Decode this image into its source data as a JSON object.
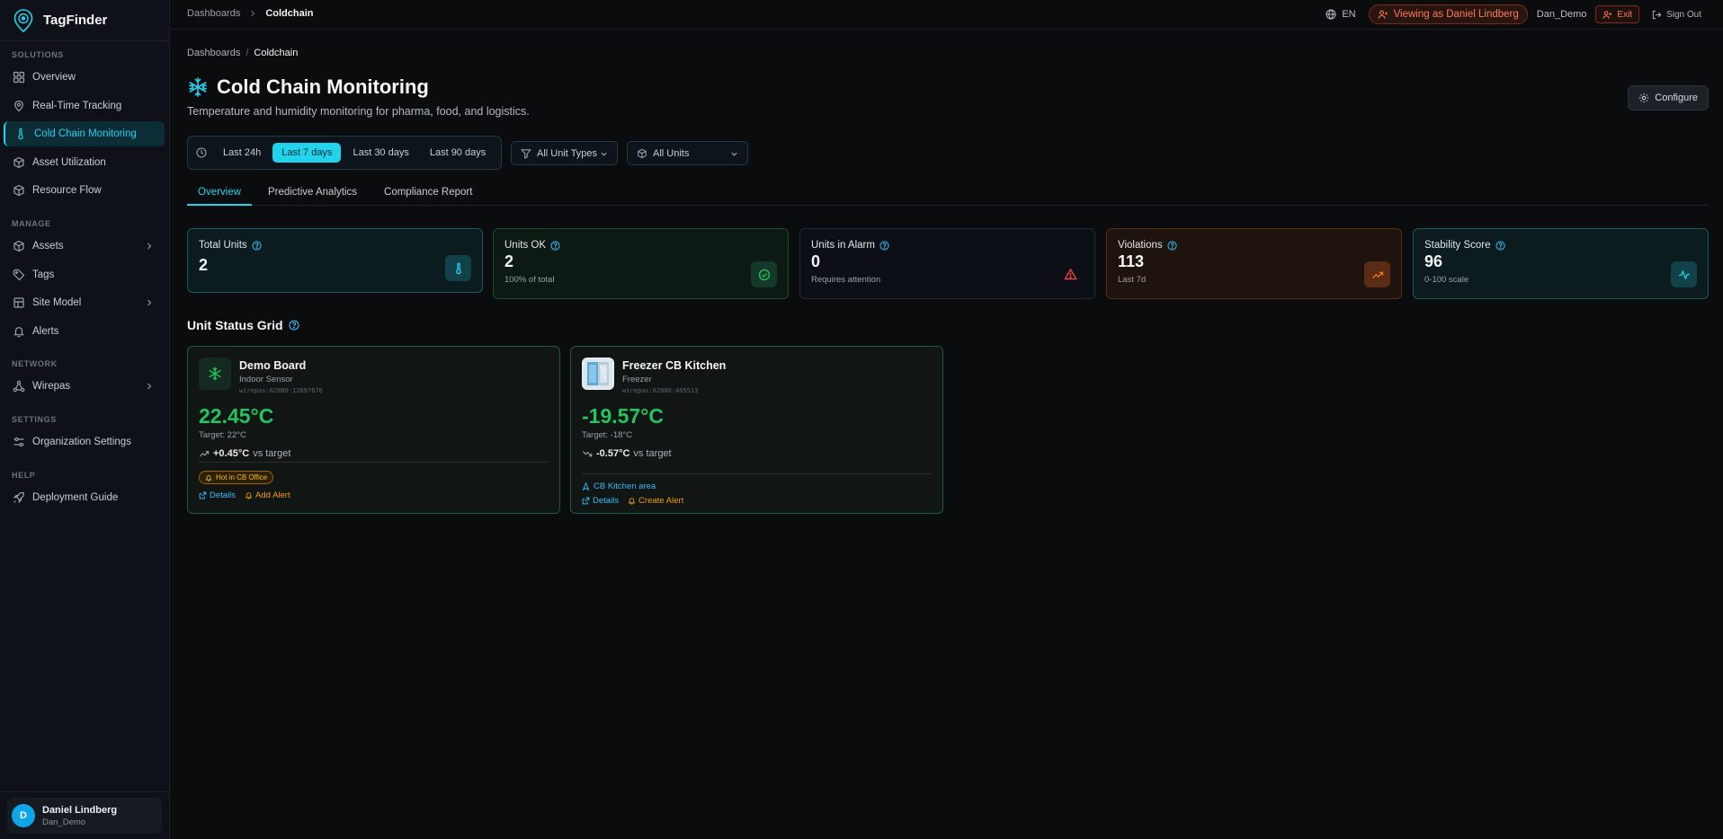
{
  "app": {
    "name": "TagFinder"
  },
  "sidebar": {
    "sections": [
      {
        "label": "SOLUTIONS"
      },
      {
        "label": "MANAGE"
      },
      {
        "label": "NETWORK"
      },
      {
        "label": "SETTINGS"
      },
      {
        "label": "HELP"
      }
    ],
    "items": [
      {
        "label": "Overview",
        "icon": "dashboard-icon"
      },
      {
        "label": "Real-Time Tracking",
        "icon": "map-pin-icon"
      },
      {
        "label": "Cold Chain Monitoring",
        "icon": "thermometer-icon",
        "active": true
      },
      {
        "label": "Asset Utilization",
        "icon": "cube-icon"
      },
      {
        "label": "Resource Flow",
        "icon": "cube-icon"
      },
      {
        "label": "Assets",
        "icon": "cube-icon"
      },
      {
        "label": "Tags",
        "icon": "tag-icon"
      },
      {
        "label": "Site Model",
        "icon": "layers-icon"
      },
      {
        "label": "Alerts",
        "icon": "bell-icon"
      },
      {
        "label": "Wirepas",
        "icon": "network-icon"
      },
      {
        "label": "Organization Settings",
        "icon": "sliders-icon"
      },
      {
        "label": "Deployment Guide",
        "icon": "rocket-icon"
      }
    ],
    "user": {
      "initial": "D",
      "name": "Daniel Lindberg",
      "login": "Dan_Demo"
    }
  },
  "topbar": {
    "breadcrumb": [
      "Dashboards",
      "Coldchain"
    ],
    "language": "EN",
    "viewing_as": "Viewing as Daniel Lindberg",
    "demo_user": "Dan_Demo",
    "exit_label": "Exit",
    "signout_label": "Sign Out"
  },
  "page": {
    "breadcrumb": [
      "Dashboards",
      "Coldchain"
    ],
    "breadcrumb_sep": "/",
    "title": "Cold Chain Monitoring",
    "subtitle": "Temperature and humidity monitoring for pharma, food, and logistics.",
    "configure_label": "Configure"
  },
  "filters": {
    "ranges": [
      "Last 24h",
      "Last 7 days",
      "Last 30 days",
      "Last 90 days"
    ],
    "active_range": "Last 7 days",
    "unit_types": "All Unit Types",
    "units": "All Units"
  },
  "tabs": [
    "Overview",
    "Predictive Analytics",
    "Compliance Report"
  ],
  "kpis": [
    {
      "label": "Total Units",
      "value": "2",
      "sub": "",
      "icon": "thermometer-icon",
      "accent": "#22d3ee"
    },
    {
      "label": "Units OK",
      "value": "2",
      "sub": "100% of total",
      "icon": "check-circle-icon",
      "accent": "#22c55e"
    },
    {
      "label": "Units in Alarm",
      "value": "0",
      "sub": "Requires attention",
      "icon": "warning-icon",
      "accent": "#ef4444"
    },
    {
      "label": "Violations",
      "value": "113",
      "sub": "Last 7d",
      "icon": "trending-up-icon",
      "accent": "#f97316"
    },
    {
      "label": "Stability Score",
      "value": "96",
      "sub": "0-100 scale",
      "icon": "activity-icon",
      "accent": "#22d3ee"
    }
  ],
  "grid": {
    "title": "Unit Status Grid",
    "units": [
      {
        "name": "Demo Board",
        "type": "Indoor Sensor",
        "id": "wirepas:62080:12697676",
        "temp": "22.45°C",
        "target": "Target: 22°C",
        "delta": "+0.45°C",
        "delta_suffix": "vs target",
        "badge": "Hot in CB Office",
        "details_label": "Details",
        "alert_label": "Add Alert"
      },
      {
        "name": "Freezer CB Kitchen",
        "type": "Freezer",
        "id": "wirepas:62080:465513",
        "temp": "-19.57°C",
        "target": "Target: -18°C",
        "delta": "-0.57°C",
        "delta_suffix": "vs target",
        "area": "CB Kitchen area",
        "details_label": "Details",
        "alert_label": "Create Alert"
      }
    ]
  }
}
